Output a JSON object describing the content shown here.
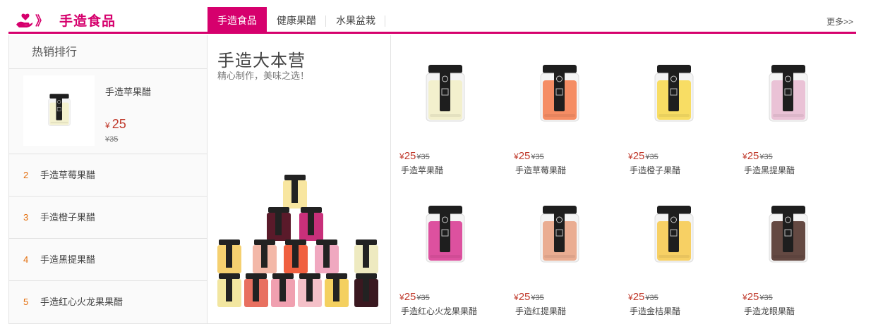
{
  "header": {
    "category_title": "手造食品",
    "arrows": "》",
    "tabs": [
      {
        "label": "手造食品",
        "active": true
      },
      {
        "label": "健康果醋",
        "active": false
      },
      {
        "label": "水果盆栽",
        "active": false
      }
    ],
    "more_label": "更多>>"
  },
  "ranking": {
    "title": "热销排行",
    "top_item": {
      "name": "手造苹果醋",
      "currency": "¥",
      "price": "25",
      "old_price": "¥35",
      "fill_color": "#f3f0c8"
    },
    "items": [
      {
        "rank": "2",
        "name": "手造草莓果醋"
      },
      {
        "rank": "3",
        "name": "手造橙子果醋"
      },
      {
        "rank": "4",
        "name": "手造黑提果醋"
      },
      {
        "rank": "5",
        "name": "手造红心火龙果果醋"
      }
    ]
  },
  "banner": {
    "title": "手造大本营",
    "subtitle": "精心制作，美味之选！"
  },
  "products": [
    {
      "name": "手造苹果醋",
      "currency": "¥",
      "price": "25",
      "old_price": "¥35",
      "fill_color": "#f2efc6"
    },
    {
      "name": "手造草莓果醋",
      "currency": "¥",
      "price": "25",
      "old_price": "¥35",
      "fill_color": "#f47a4a"
    },
    {
      "name": "手造橙子果醋",
      "currency": "¥",
      "price": "25",
      "old_price": "¥35",
      "fill_color": "#f8d84a"
    },
    {
      "name": "手造黑提果醋",
      "currency": "¥",
      "price": "25",
      "old_price": "¥35",
      "fill_color": "#e8b8d0"
    },
    {
      "name": "手造红心火龙果果醋",
      "currency": "¥",
      "price": "25",
      "old_price": "¥35",
      "fill_color": "#d8348f"
    },
    {
      "name": "手造红提果醋",
      "currency": "¥",
      "price": "25",
      "old_price": "¥35",
      "fill_color": "#e8a080"
    },
    {
      "name": "手造金桔果醋",
      "currency": "¥",
      "price": "25",
      "old_price": "¥35",
      "fill_color": "#f7c94a"
    },
    {
      "name": "手造龙眼果醋",
      "currency": "¥",
      "price": "25",
      "old_price": "¥35",
      "fill_color": "#4a2a22"
    }
  ],
  "colors": {
    "accent": "#d6006d",
    "price": "#c0392b",
    "rank_number": "#e36c09"
  },
  "icons": {
    "logo": "heart-hand-icon"
  }
}
